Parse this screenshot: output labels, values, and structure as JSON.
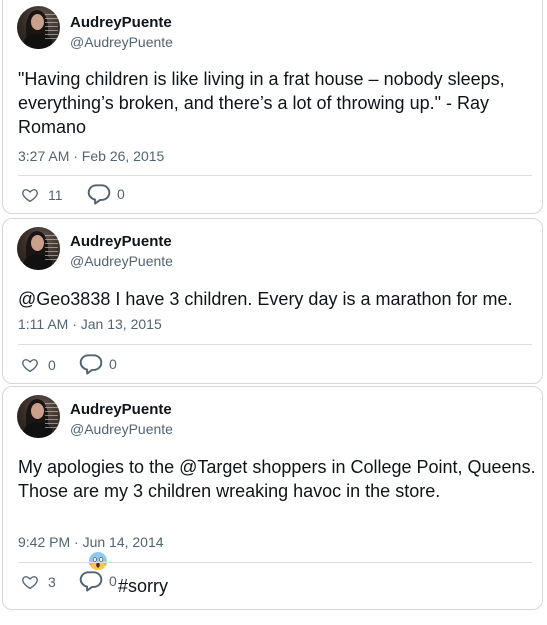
{
  "tweets": [
    {
      "user": {
        "display_name": "AudreyPuente",
        "handle": "@AudreyPuente"
      },
      "text": "\"Having children is like living in a frat house – nobody sleeps, everything’s broken, and there’s a lot of throwing up.\" - Ray Romano",
      "timestamp": "3:27 AM · Feb 26, 2015",
      "likes": "11",
      "replies": "0"
    },
    {
      "user": {
        "display_name": "AudreyPuente",
        "handle": "@AudreyPuente"
      },
      "text": "@Geo3838 I have 3 children. Every day is a marathon for me.",
      "timestamp": "1:11 AM · Jan 13, 2015",
      "likes": "0",
      "replies": "0"
    },
    {
      "user": {
        "display_name": "AudreyPuente",
        "handle": "@AudreyPuente"
      },
      "text": "My apologies to the @Target shoppers in College Point, Queens. Those are my 3 children wreaking havoc in the store.",
      "emoji_icon": "face-screaming-in-fear-icon",
      "hashtag": "#sorry",
      "timestamp": "9:42 PM · Jun 14, 2014",
      "likes": "3",
      "replies": "0"
    }
  ],
  "colors": {
    "text_primary": "#0f1419",
    "text_secondary": "#536471",
    "border": "#d4d8db",
    "icon": "#536471"
  },
  "icons": {
    "like": "heart-outline-icon",
    "reply": "speech-bubble-icon"
  }
}
